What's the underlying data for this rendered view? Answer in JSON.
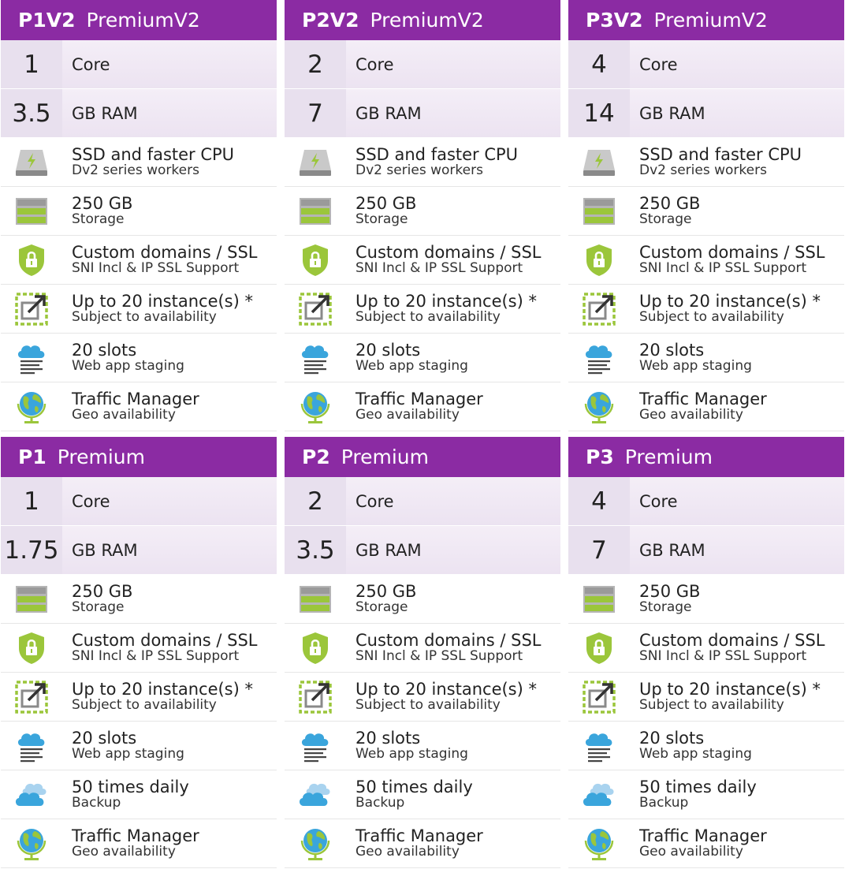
{
  "cards": [
    {
      "code": "P1V2",
      "tier": "PremiumV2",
      "specs": [
        {
          "value": "1",
          "label": "Core"
        },
        {
          "value": "3.5",
          "label": "GB RAM"
        }
      ],
      "features": [
        {
          "icon": "ssd-icon",
          "title": "SSD and faster CPU",
          "subtitle": "Dv2 series workers"
        },
        {
          "icon": "storage-icon",
          "title": "250 GB",
          "subtitle": "Storage"
        },
        {
          "icon": "ssl-shield-icon",
          "title": "Custom domains / SSL",
          "subtitle": "SNI Incl & IP SSL Support"
        },
        {
          "icon": "scale-out-icon",
          "title": "Up to 20 instance(s) *",
          "subtitle": "Subject to availability"
        },
        {
          "icon": "slots-cloud-icon",
          "title": "20 slots",
          "subtitle": "Web app staging"
        },
        {
          "icon": "globe-icon",
          "title": "Traffic Manager",
          "subtitle": "Geo availability"
        }
      ]
    },
    {
      "code": "P2V2",
      "tier": "PremiumV2",
      "specs": [
        {
          "value": "2",
          "label": "Core"
        },
        {
          "value": "7",
          "label": "GB RAM"
        }
      ],
      "features": [
        {
          "icon": "ssd-icon",
          "title": "SSD and faster CPU",
          "subtitle": "Dv2 series workers"
        },
        {
          "icon": "storage-icon",
          "title": "250 GB",
          "subtitle": "Storage"
        },
        {
          "icon": "ssl-shield-icon",
          "title": "Custom domains / SSL",
          "subtitle": "SNI Incl & IP SSL Support"
        },
        {
          "icon": "scale-out-icon",
          "title": "Up to 20 instance(s) *",
          "subtitle": "Subject to availability"
        },
        {
          "icon": "slots-cloud-icon",
          "title": "20 slots",
          "subtitle": "Web app staging"
        },
        {
          "icon": "globe-icon",
          "title": "Traffic Manager",
          "subtitle": "Geo availability"
        }
      ]
    },
    {
      "code": "P3V2",
      "tier": "PremiumV2",
      "specs": [
        {
          "value": "4",
          "label": "Core"
        },
        {
          "value": "14",
          "label": "GB RAM"
        }
      ],
      "features": [
        {
          "icon": "ssd-icon",
          "title": "SSD and faster CPU",
          "subtitle": "Dv2 series workers"
        },
        {
          "icon": "storage-icon",
          "title": "250 GB",
          "subtitle": "Storage"
        },
        {
          "icon": "ssl-shield-icon",
          "title": "Custom domains / SSL",
          "subtitle": "SNI Incl & IP SSL Support"
        },
        {
          "icon": "scale-out-icon",
          "title": "Up to 20 instance(s) *",
          "subtitle": "Subject to availability"
        },
        {
          "icon": "slots-cloud-icon",
          "title": "20 slots",
          "subtitle": "Web app staging"
        },
        {
          "icon": "globe-icon",
          "title": "Traffic Manager",
          "subtitle": "Geo availability"
        }
      ]
    },
    {
      "code": "P1",
      "tier": "Premium",
      "specs": [
        {
          "value": "1",
          "label": "Core"
        },
        {
          "value": "1.75",
          "label": "GB RAM"
        }
      ],
      "features": [
        {
          "icon": "storage-icon",
          "title": "250 GB",
          "subtitle": "Storage"
        },
        {
          "icon": "ssl-shield-icon",
          "title": "Custom domains / SSL",
          "subtitle": "SNI Incl & IP SSL Support"
        },
        {
          "icon": "scale-out-icon",
          "title": "Up to 20 instance(s) *",
          "subtitle": "Subject to availability"
        },
        {
          "icon": "slots-cloud-icon",
          "title": "20 slots",
          "subtitle": "Web app staging"
        },
        {
          "icon": "backup-cloud-icon",
          "title": "50 times daily",
          "subtitle": "Backup"
        },
        {
          "icon": "globe-icon",
          "title": "Traffic Manager",
          "subtitle": "Geo availability"
        }
      ]
    },
    {
      "code": "P2",
      "tier": "Premium",
      "specs": [
        {
          "value": "2",
          "label": "Core"
        },
        {
          "value": "3.5",
          "label": "GB RAM"
        }
      ],
      "features": [
        {
          "icon": "storage-icon",
          "title": "250 GB",
          "subtitle": "Storage"
        },
        {
          "icon": "ssl-shield-icon",
          "title": "Custom domains / SSL",
          "subtitle": "SNI Incl & IP SSL Support"
        },
        {
          "icon": "scale-out-icon",
          "title": "Up to 20 instance(s) *",
          "subtitle": "Subject to availability"
        },
        {
          "icon": "slots-cloud-icon",
          "title": "20 slots",
          "subtitle": "Web app staging"
        },
        {
          "icon": "backup-cloud-icon",
          "title": "50 times daily",
          "subtitle": "Backup"
        },
        {
          "icon": "globe-icon",
          "title": "Traffic Manager",
          "subtitle": "Geo availability"
        }
      ]
    },
    {
      "code": "P3",
      "tier": "Premium",
      "specs": [
        {
          "value": "4",
          "label": "Core"
        },
        {
          "value": "7",
          "label": "GB RAM"
        }
      ],
      "features": [
        {
          "icon": "storage-icon",
          "title": "250 GB",
          "subtitle": "Storage"
        },
        {
          "icon": "ssl-shield-icon",
          "title": "Custom domains / SSL",
          "subtitle": "SNI Incl & IP SSL Support"
        },
        {
          "icon": "scale-out-icon",
          "title": "Up to 20 instance(s) *",
          "subtitle": "Subject to availability"
        },
        {
          "icon": "slots-cloud-icon",
          "title": "20 slots",
          "subtitle": "Web app staging"
        },
        {
          "icon": "backup-cloud-icon",
          "title": "50 times daily",
          "subtitle": "Backup"
        },
        {
          "icon": "globe-icon",
          "title": "Traffic Manager",
          "subtitle": "Geo availability"
        }
      ]
    }
  ],
  "colors": {
    "header": "#8b2ba3",
    "icon_green": "#9bc63b",
    "icon_blue": "#3aa5dc",
    "icon_gray": "#a0a0a0"
  }
}
